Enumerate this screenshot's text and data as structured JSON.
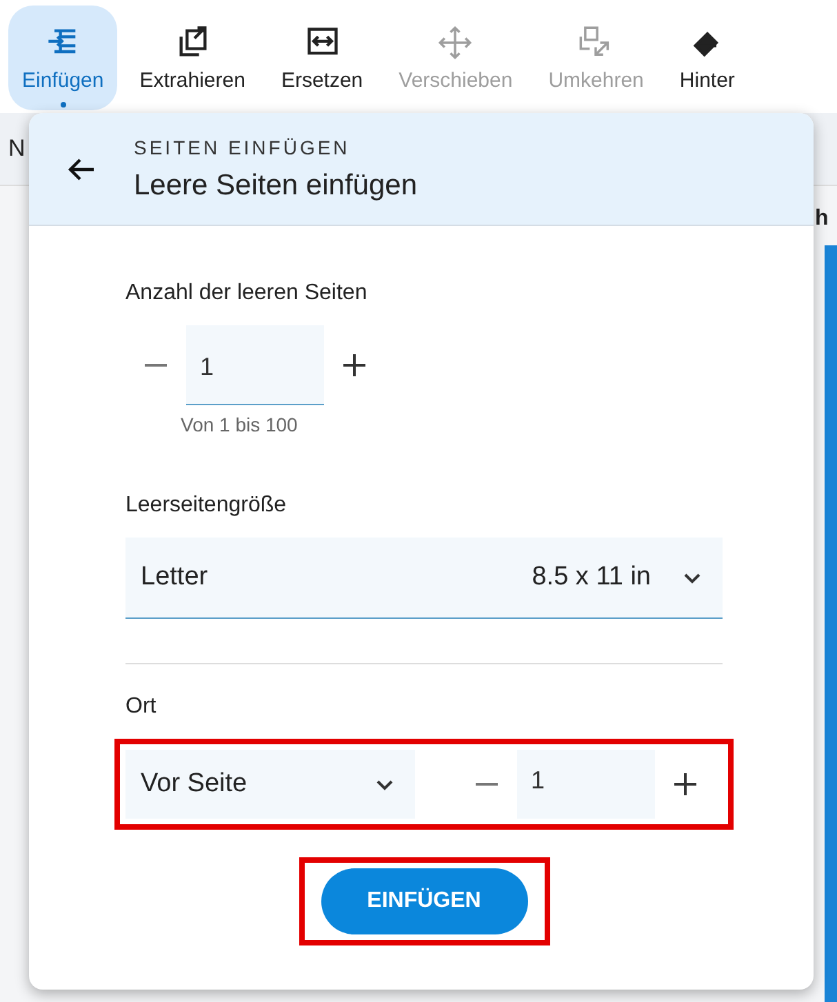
{
  "toolbar": {
    "items": [
      {
        "label": "Einfügen",
        "selected": true,
        "disabled": false
      },
      {
        "label": "Extrahieren",
        "selected": false,
        "disabled": false
      },
      {
        "label": "Ersetzen",
        "selected": false,
        "disabled": false
      },
      {
        "label": "Verschieben",
        "selected": false,
        "disabled": true
      },
      {
        "label": "Umkehren",
        "selected": false,
        "disabled": true
      },
      {
        "label": "Hinter",
        "selected": false,
        "disabled": false
      }
    ]
  },
  "background": {
    "tab_fragment": "N",
    "side_fragment": "h"
  },
  "panel": {
    "eyebrow": "SEITEN EINFÜGEN",
    "title": "Leere Seiten einfügen",
    "count": {
      "label": "Anzahl der leeren Seiten",
      "value": "1",
      "hint": "Von 1 bis 100"
    },
    "size": {
      "label": "Leerseitengröße",
      "value": "Letter",
      "detail": "8.5 x 11 in"
    },
    "location": {
      "label": "Ort",
      "position": "Vor Seite",
      "page": "1",
      "highlighted": true
    },
    "submit": {
      "label": "EINFÜGEN",
      "highlighted": true
    }
  }
}
